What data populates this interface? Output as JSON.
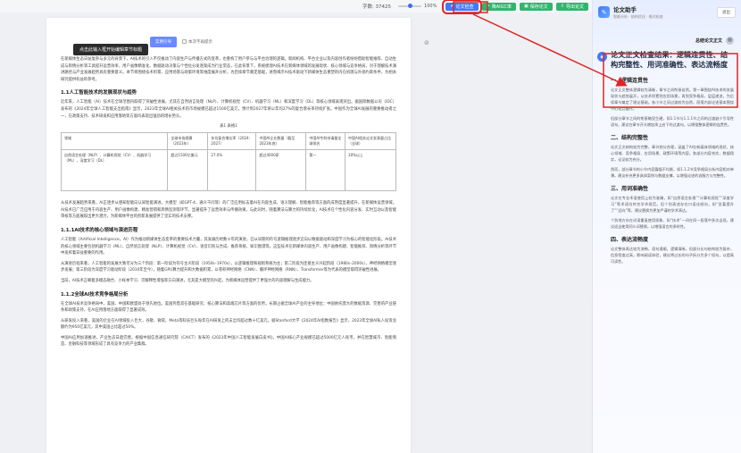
{
  "toolbar": {
    "word_count_label": "字数: 37425",
    "zoom_pct": "100%",
    "zoom_level": 0.5,
    "btn_check": "论文检查",
    "btn_ai_rewrite": "降AIGC率",
    "btn_save": "保存论文",
    "btn_export": "导出论文"
  },
  "document": {
    "tooltip": "点击此输入框开始编辑章节标题",
    "title_button": "实例引导",
    "checkbox_label": "本次不再提示",
    "p1": "在新媒体生态日益复杂与多元的背景下，AI技术的引入不仅推动了内容生产与传播方式的变革，也重构了用户参与与平台治理的逻辑。新闻机构、平台企业以及内容创作者纷纷借助智能推荐、自动生成与舆情分析等工具提升运营效率，用户画像精准化、数据驱动决策与个性化分发逐渐成为行业常态，在此背景下，系统梳理AI技术在新媒体领域的发展现状、核心领域与竞争格局，对于理解技术演进路径与产业发展趋势具有重要意义。本节将围绕技术积累、应用场景与政策环境等维度展开分析，为后续章节奠定基础，进而揭示AI技术驱动下新媒体生态重塑的内在机理与外部约束条件，为相关研究提供有益的参考。",
    "h1": "1.1人工智能技术的发展现状与趋势",
    "p2": "近年来，人工智能（AI）技术在全球范围内取得了突破性进展，尤其在自然语言处理（NLP）、计算机视觉（CV）、机器学习（ML）和深度学习（DL）等核心领域表现突出。据国际数据公司（IDC）发布的《2024年全球人工智能支出指南》显示，2023年全球AI相关技术的市场规模已超过1500亿美元，预计到2027年将以年均27%的复合增长率持续扩张。中国作为全球AI发展的重要推动者之一，在政策支持、技术研发和应用落地等方面均表现出强劲的增长势头。",
    "table_caption": "表1  表格1",
    "table_headers": [
      "领域",
      "全球市场规模（2023年）",
      "年均复合增长率（2024-2027）",
      "中国AI企业数量（截至2023年底）",
      "中国AI专利申请量全球排名",
      "中国AI相关论文发表量占比（全球）"
    ],
    "table_row": [
      "自然语言处理（NLP）、计算机视觉（CV）、机器学习（ML）、深度学习（DL）",
      "超过1500亿美元",
      "27.0%",
      "超过4000家",
      "第一",
      "30%以上"
    ],
    "p3": "从技术发展趋势来看，AI正逐步从感知智能向认知智能演进。大模型（如GPT-4、通义千问等）的广泛应用标志着AI在内容生成、语义理解、智能推荐等方面的成熟度显著提升，在新媒体运营领域，AI技术已广泛应用于内容生产、用户画像构建、精准营销和舆情监测等环节，显著提升了运营效率与传播效果。与此同时，随着算法与算力的持续优化，AI技术在个性化内容分发、实时互动以及智能审核等方面展现出更大潜力，为新媒体平台的创新发展提供了坚实的技术支撑。",
    "h2": "1.1.1AI技术的核心领域与演进历程",
    "p4": "人工智能（Artificial Intelligence，AI）作为推动新媒体生态变革的重要技术力量，其发展历经数十年的演进，已从早期的符号逻辑推理逐步迈向以数据驱动和深度学习为核心的智能化阶段。AI技术的核心领域主要包括机器学习（ML）、自然语言处理（NLP）、计算机视觉（CV）、语音识别与合成、推荐系统、知识图谱等。这些技术在新媒体内容生产、用户画像构建、智能推荐、舆情分析等环节中发挥着日益重要的作用。",
    "p5": "从演进历程来看，人工智能的发展大致可分为三个阶段：第一阶段为符号主义阶段（1950s–1970s），以逻辑推理和规则系统为主；第二阶段为连接主义兴起阶段（1980s–2000s），神经网络模型逐步发展；第三阶段为深度学习驱动阶段（2010年至今），随着GPU算力提升和大数据积累，以卷积神经网络（CNN）、循环神经网络（RNN）、Transformer等为代表的模型取得突破性进展。",
    "p6": "当前，AI技术正朝着多模态融合、小样本学习、可解释性增强等方向演进，尤其是大模型的兴起，为新媒体运营提供了更强大的内容理解与生成能力。",
    "h3": "1.1.2全球AI技术竞争格局分析",
    "p7": "在全球AI技术竞争格局中，美国、中国和欧盟处于领先地位。美国凭借其在基础研究、核心算法和高端芯片等方面的优势，长期占据全球AI产业的主导地位；中国依托庞大的数据资源、完善的产业链条和政策支持，在AI应用落地方面取得了显著成效。",
    "p8": "从研发投入来看，美国的企业在AI领域投入巨大，谷歌、微软、Meta等科技巨头每年在AI研发上的支出均超过数十亿美元。据Stanford大学《2024年AI指数报告》显示，2023年全球AI私人投资总额约为950亿美元，其中美国占比超过50%。",
    "p9": "中国AI应用加速推进，产业生态日趋完善。根据中国信息通信研究院（CAICT）发布的《2023年中国人工智能发展白皮书》，中国AI核心产业规模已超过5000亿元人民币，并在智慧城市、智能制造、金融科技等领域形成了具有竞争力的产业集群。"
  },
  "assistant": {
    "title": "论文助手",
    "subtitle": "智能分析 · 结构优化 · 格式检查",
    "close_label": "退出",
    "user_query": "总结论文正文",
    "answer_title": "论文正文检查结果：逻辑连贯性、结构完整性、用词准确性、表达流畅度",
    "s1": "一、逻辑连贯性",
    "s1_p1": "论文正文整体逻辑较为清晰，章节之间衔接自然。第一章围绕AI技术的发展现状与趋势展开，从技术积累到应用场景，再到竞争格局，层层递进，为后续章节奠定了理论基础。各小节之间过渡较为自然，段落内部论述基本围绕中心论点展开。",
    "s1_p2": "但部分章节之间的衔接略显生硬，如1.1节与1.1.1节之间的过渡缺少引导性语句，建议在章节开头增加承上启下的过渡句，以增强整体逻辑的连贯性。",
    "s2": "二、结构完整性",
    "s2_p1": "论文正文结构较为完整，章节划分合理，涵盖了AI在新媒体领域的现状、核心领域、竞争格局、应用场景、政策环境等内容。各部分内容充实，数据翔实，论证较为充分。",
    "s2_p2": "然而，部分章节的小节内容篇幅不均衡，如1.1.2节竞争格局分析内容相对单薄，建议补充更多具体案例与数据支撑，以增强论述的说服力与完整性。",
    "s3": "三、用词准确性",
    "s3_p1": "论文在专业术语使用上较为准确，如“自然语言处理”“计算机视觉”“深度学习”等术语均符合学术规范。但个别表述存在口语化倾向，如“显著提升了”“迈向”等，建议替换为更加严谨的学术表达。",
    "s3_p2": "个别地方存在词语重复使用现象，如“技术”一词在同一段落中多次出现，建议适当使用同义词替换，以增强语言的多样性。",
    "s4": "四、表达流畅度",
    "s4_p1": "论文整体表达较为流畅，语句通顺，逻辑清晰。但部分长句结构较为复杂，信息密度过高，影响阅读体验，建议将过长的句子拆分为多个短句，以提高可读性。"
  },
  "colors": {
    "accent": "#3e7bfa",
    "green": "#2fb56e",
    "annotation_red": "#e02424"
  }
}
